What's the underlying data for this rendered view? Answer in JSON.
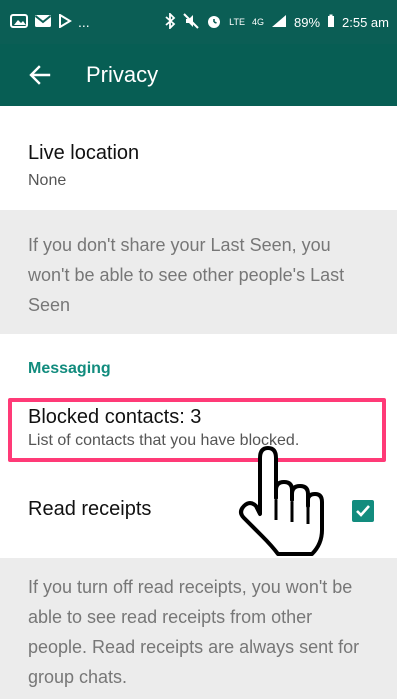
{
  "status_bar": {
    "left_text": "...",
    "lte": "LTE",
    "network": "4G",
    "battery_percent": "89%",
    "time": "2:55 am"
  },
  "app_bar": {
    "title": "Privacy"
  },
  "items": {
    "live_location": {
      "title": "Live location",
      "subtitle": "None"
    },
    "last_seen_info": "If you don't share your Last Seen, you won't be able to see other people's Last Seen",
    "messaging_header": "Messaging",
    "blocked_contacts": {
      "title": "Blocked contacts: 3",
      "subtitle": "List of contacts that you have blocked."
    },
    "read_receipts": {
      "title": "Read receipts",
      "checked": true
    },
    "read_receipts_info": "If you turn off read receipts, you won't be able to see read receipts from other people. Read receipts are always sent for group chats."
  },
  "colors": {
    "appbar": "#075e54",
    "accent": "#128c7e",
    "highlight": "#ff3a77"
  }
}
